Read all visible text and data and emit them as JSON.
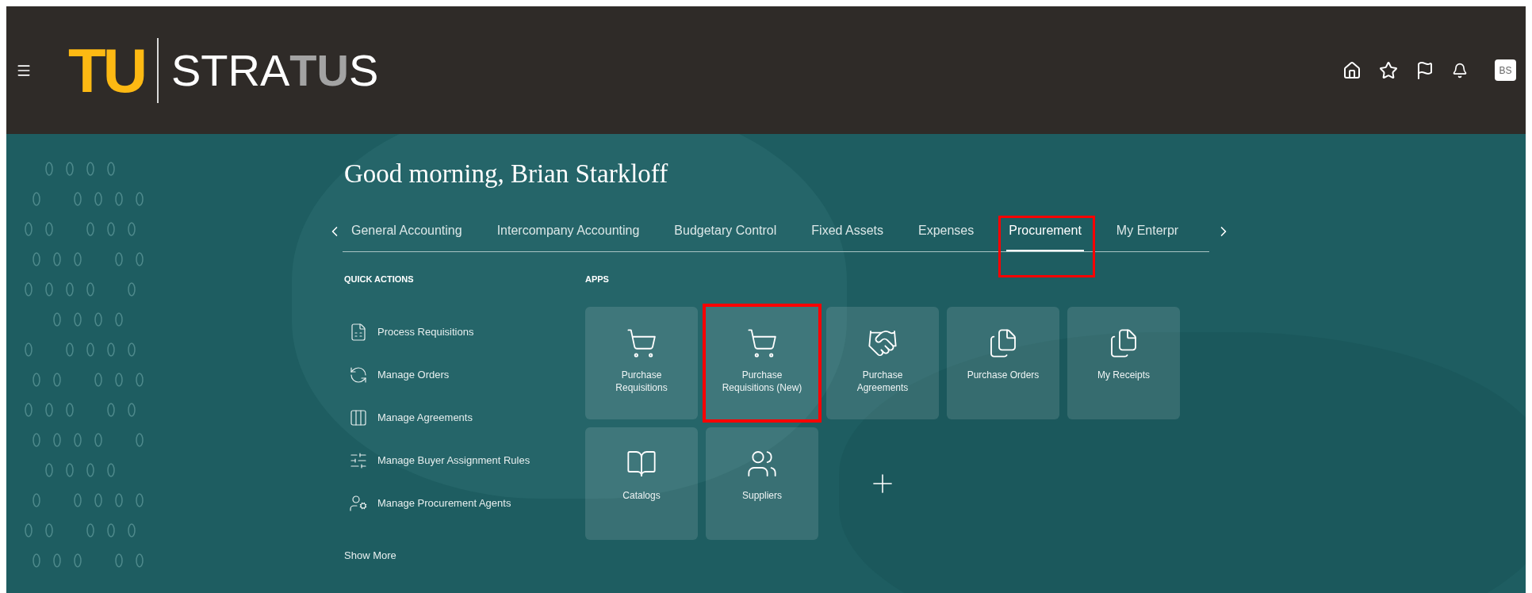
{
  "header": {
    "logo": {
      "mark": "TU",
      "wordmark": [
        {
          "text": "STRA",
          "emphasized": false
        },
        {
          "text": "TU",
          "emphasized": true
        },
        {
          "text": "S",
          "emphasized": false
        }
      ]
    },
    "avatar": "BS"
  },
  "greeting": "Good morning, Brian Starkloff",
  "tabs": [
    {
      "label": "General Accounting",
      "selected": false,
      "highlighted": false
    },
    {
      "label": "Intercompany Accounting",
      "selected": false,
      "highlighted": false
    },
    {
      "label": "Budgetary Control",
      "selected": false,
      "highlighted": false
    },
    {
      "label": "Fixed Assets",
      "selected": false,
      "highlighted": false
    },
    {
      "label": "Expenses",
      "selected": false,
      "highlighted": false
    },
    {
      "label": "Procurement",
      "selected": true,
      "highlighted": true
    },
    {
      "label": "My Enterpr",
      "selected": false,
      "highlighted": false
    }
  ],
  "quick_actions": {
    "title": "QUICK ACTIONS",
    "items": [
      {
        "label": "Process Requisitions",
        "kind": "requisitions"
      },
      {
        "label": "Manage Orders",
        "kind": "orders"
      },
      {
        "label": "Manage Agreements",
        "kind": "agreements"
      },
      {
        "label": "Manage Buyer Assignment Rules",
        "kind": "rules"
      },
      {
        "label": "Manage Procurement Agents",
        "kind": "agents"
      }
    ],
    "show_more": "Show More"
  },
  "apps": {
    "title": "APPS",
    "tiles": [
      {
        "label": "Purchase Requisitions",
        "kind": "cart",
        "highlighted": false
      },
      {
        "label": "Purchase Requisitions (New)",
        "kind": "cart",
        "highlighted": true
      },
      {
        "label": "Purchase Agreements",
        "kind": "handshake",
        "highlighted": false
      },
      {
        "label": "Purchase Orders",
        "kind": "documents",
        "highlighted": false
      },
      {
        "label": "My Receipts",
        "kind": "documents",
        "highlighted": false
      },
      {
        "label": "Catalogs",
        "kind": "book",
        "highlighted": false
      },
      {
        "label": "Suppliers",
        "kind": "people",
        "highlighted": false
      }
    ]
  }
}
